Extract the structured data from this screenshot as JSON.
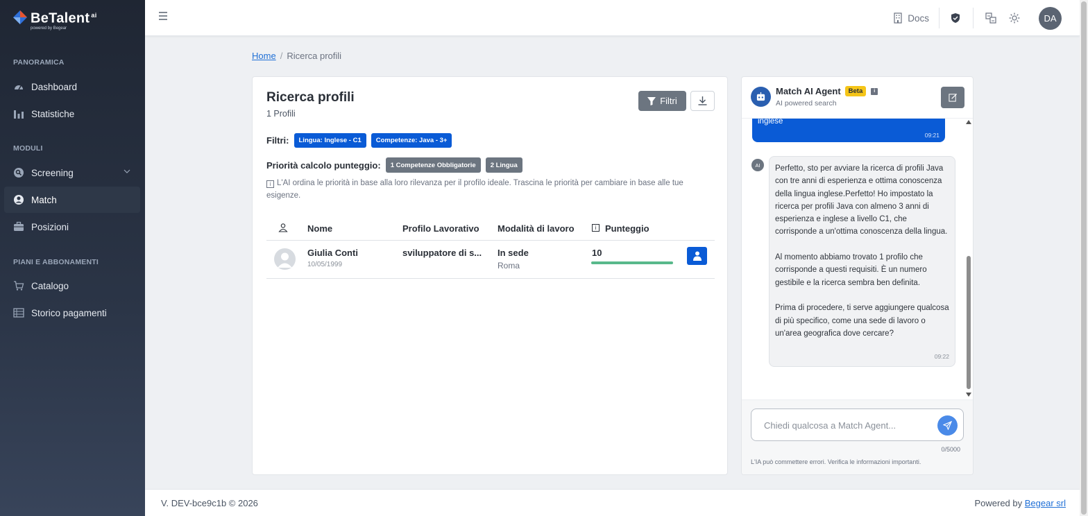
{
  "app": {
    "name": "BeTalent",
    "name_sup": "ai",
    "tagline": "powered by Begear"
  },
  "sidebar": {
    "sections": [
      {
        "title": "PANORAMICA",
        "items": [
          {
            "label": "Dashboard",
            "icon": "gauge-icon"
          },
          {
            "label": "Statistiche",
            "icon": "bar-chart-icon"
          }
        ]
      },
      {
        "title": "MODULI",
        "items": [
          {
            "label": "Screening",
            "icon": "screening-icon",
            "has_chevron": true
          },
          {
            "label": "Match",
            "icon": "user-circle-icon",
            "active": true
          },
          {
            "label": "Posizioni",
            "icon": "briefcase-icon"
          }
        ]
      },
      {
        "title": "PIANI E ABBONAMENTI",
        "items": [
          {
            "label": "Catalogo",
            "icon": "cart-icon"
          },
          {
            "label": "Storico pagamenti",
            "icon": "ledger-icon"
          }
        ]
      }
    ]
  },
  "topbar": {
    "docs_label": "Docs",
    "avatar_initials": "DA"
  },
  "breadcrumb": {
    "home": "Home",
    "separator": "/",
    "current": "Ricerca profili"
  },
  "main": {
    "title": "Ricerca profili",
    "count": "1 Profili",
    "filter_button": "Filtri",
    "filters_label": "Filtri:",
    "filters": [
      "Lingua: Inglese - C1",
      "Competenze: Java - 3+"
    ],
    "priority_label": "Priorità calcolo punteggio:",
    "priorities": [
      "1  Competenze Obbligatorie",
      "2  Lingua"
    ],
    "hint_icon": "i",
    "hint": "L'AI ordina le priorità in base alla loro rilevanza per il profilo ideale. Trascina le priorità per cambiare in base alle tue esigenze.",
    "table": {
      "columns": {
        "name": "Nome",
        "profile": "Profilo Lavorativo",
        "mode": "Modalità di lavoro",
        "score": "Punteggio"
      },
      "score_info_icon": "i",
      "rows": [
        {
          "name": "Giulia Conti",
          "birth": "10/05/1999",
          "profile": "sviluppatore di s...",
          "mode": "In sede",
          "city": "Roma",
          "score": "10",
          "score_fraction": 1.0
        }
      ]
    }
  },
  "chat": {
    "title": "Match AI Agent",
    "beta": "Beta",
    "info_icon": "i",
    "subtitle": "AI powered search",
    "user_message": {
      "text": "inglese",
      "time": "09:21"
    },
    "ai_badge": "AI",
    "ai_message": {
      "paragraphs": [
        "Perfetto, sto per avviare la ricerca di profili Java con tre anni di esperienza e ottima conoscenza della lingua inglese.Perfetto! Ho impostato la ricerca per profili Java con almeno 3 anni di esperienza e inglese a livello C1, che corrisponde a un'ottima conoscenza della lingua.",
        "Al momento abbiamo trovato 1 profilo che corrisponde a questi requisiti. È un numero gestibile e la ricerca sembra ben definita.",
        "Prima di procedere, ti serve aggiungere qualcosa di più specifico, come una sede di lavoro o un'area geografica dove cercare?"
      ],
      "time": "09:22"
    },
    "input_placeholder": "Chiedi qualcosa a Match Agent...",
    "counter": "0/5000",
    "disclaimer": "L'IA può commettere errori. Verifica le informazioni importanti."
  },
  "footer": {
    "version": "V. DEV-bce9c1b © 2026",
    "powered_prefix": "Powered by",
    "powered_link": "Begear srl"
  },
  "colors": {
    "primary": "#0a5bd6",
    "sidebar": "#1f2633",
    "gray_button": "#6c7580",
    "score_bar": "#58b98b",
    "beta": "#f5c518"
  }
}
